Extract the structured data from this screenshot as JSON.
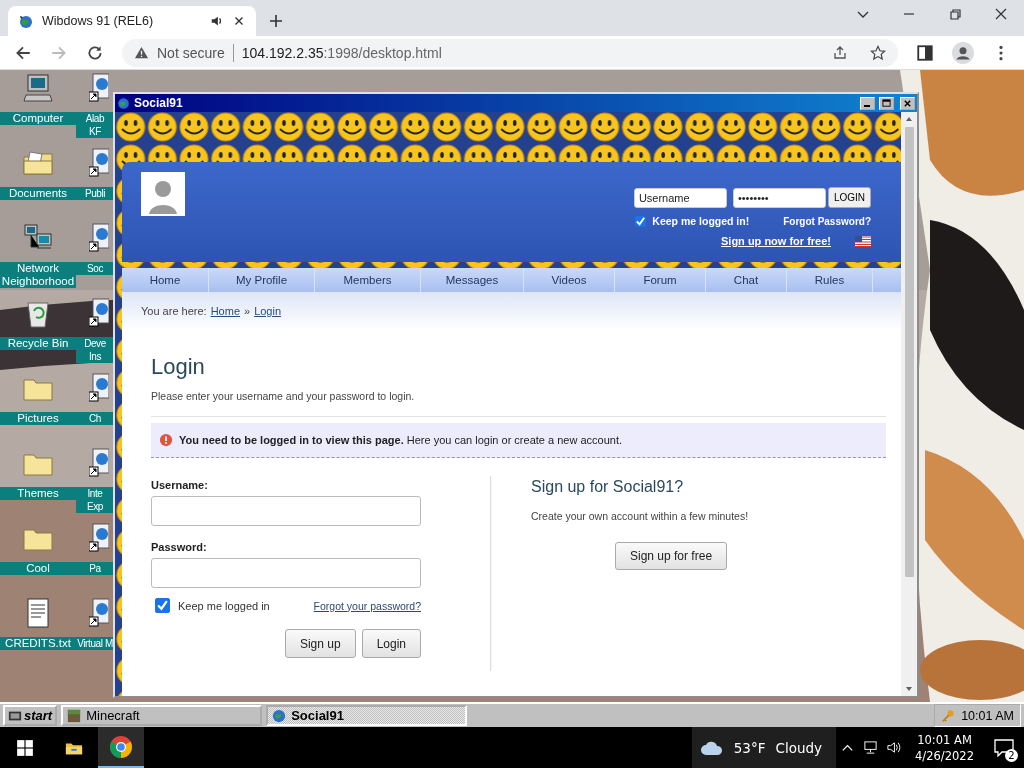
{
  "browser": {
    "tab": {
      "title": "Wibdows 91 (REL6)"
    },
    "omnibox": {
      "security": "Not secure",
      "host": "104.192.2.35",
      "path": ":1998/desktop.html"
    }
  },
  "desktop": {
    "icons": [
      {
        "label": "Computer",
        "kind": "computer"
      },
      {
        "label": "Documents",
        "kind": "documents"
      },
      {
        "label": "Network Neighborhood",
        "kind": "network"
      },
      {
        "label": "Recycle Bin",
        "kind": "recycle-bin"
      },
      {
        "label": "Pictures",
        "kind": "folder"
      },
      {
        "label": "Themes",
        "kind": "folder"
      },
      {
        "label": "Cool",
        "kind": "folder"
      },
      {
        "label": "CREDITS.txt",
        "kind": "text-file"
      }
    ],
    "shortcuts": [
      {
        "label": "Alab\nKF"
      },
      {
        "label": "Publi"
      },
      {
        "label": "Soc"
      },
      {
        "label": "Deve\nIns"
      },
      {
        "label": "Ch"
      },
      {
        "label": "Inte\nExp"
      },
      {
        "label": "Pa"
      },
      {
        "label": "Virtual M"
      }
    ]
  },
  "window": {
    "title": "Social91"
  },
  "site": {
    "header_login": {
      "username": "Username",
      "password": "••••••••",
      "button": "LOGIN",
      "remember": {
        "label": "Keep me logged in!",
        "checked": true
      },
      "forgot": "Forgot Password?",
      "signup": "Sign up now for free!"
    },
    "nav": [
      "Home",
      "My Profile",
      "Members",
      "Messages",
      "Videos",
      "Forum",
      "Chat",
      "Rules"
    ],
    "breadcrumb": {
      "prefix": "You are here:",
      "links": [
        "Home",
        "Login"
      ],
      "separator": "»"
    },
    "heading": "Login",
    "intro": "Please enter your username and your password to login.",
    "notice": "**You need to be logged in to view this page.** Here you can login or create a new account.",
    "form": {
      "username_label": "Username:",
      "password_label": "Password:",
      "remember": {
        "label": "Keep me logged in",
        "checked": true
      },
      "forgot": "Forgot your password?",
      "buttons": [
        "Sign up",
        "Login"
      ]
    },
    "signup": {
      "title": "Sign up for Social91?",
      "text": "Create your own account within a few minutes!",
      "button": "Sign up for free"
    }
  },
  "taskbar": {
    "start": "start",
    "tasks": [
      {
        "label": "Minecraft",
        "kind": "block",
        "selected": false
      },
      {
        "label": "Social91",
        "kind": "globe",
        "selected": true
      }
    ],
    "clock": "10:01 AM"
  },
  "system_taskbar": {
    "weather": {
      "temp": "53°F",
      "condition": "Cloudy"
    },
    "time": "10:01 AM",
    "date": "4/26/2022",
    "notifications": "2"
  }
}
